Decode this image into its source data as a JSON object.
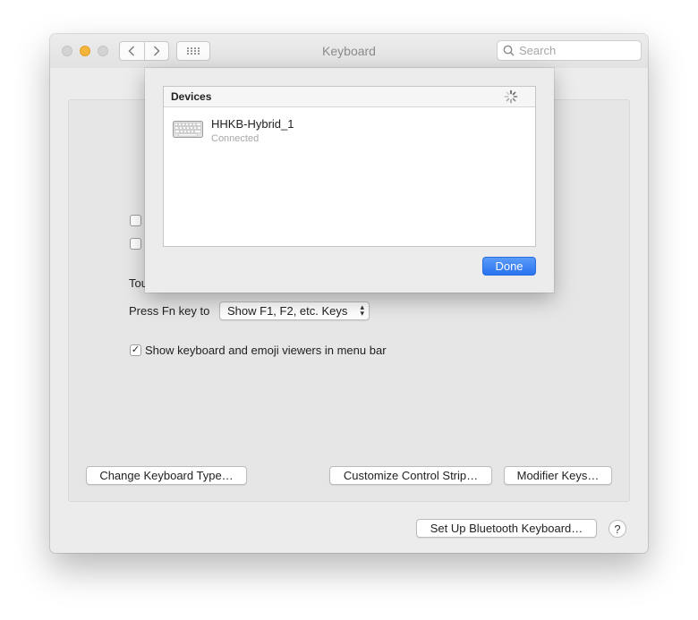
{
  "window": {
    "title": "Keyboard",
    "search_placeholder": "Search",
    "back_glyph": "‹",
    "forward_glyph": "›"
  },
  "main": {
    "touch_bar_label_partial": "Tou",
    "fn_key_label": "Press Fn key to",
    "fn_key_select_value": "Show F1, F2, etc. Keys",
    "show_viewers_label": "Show keyboard and emoji viewers in menu bar",
    "show_viewers_checked": true,
    "checkbox_1_checked": false,
    "checkbox_2_checked": false,
    "buttons": {
      "change_keyboard_type": "Change Keyboard Type…",
      "customize_control_strip": "Customize Control Strip…",
      "modifier_keys": "Modifier Keys…"
    }
  },
  "footer": {
    "bluetooth_button": "Set Up Bluetooth Keyboard…",
    "help_glyph": "?"
  },
  "sheet": {
    "header": "Devices",
    "devices": [
      {
        "name": "HHKB-Hybrid_1",
        "status": "Connected",
        "icon": "keyboard-icon"
      }
    ],
    "done_label": "Done"
  },
  "colors": {
    "accent": "#2f7bf5",
    "minimize": "#f5b43a"
  }
}
